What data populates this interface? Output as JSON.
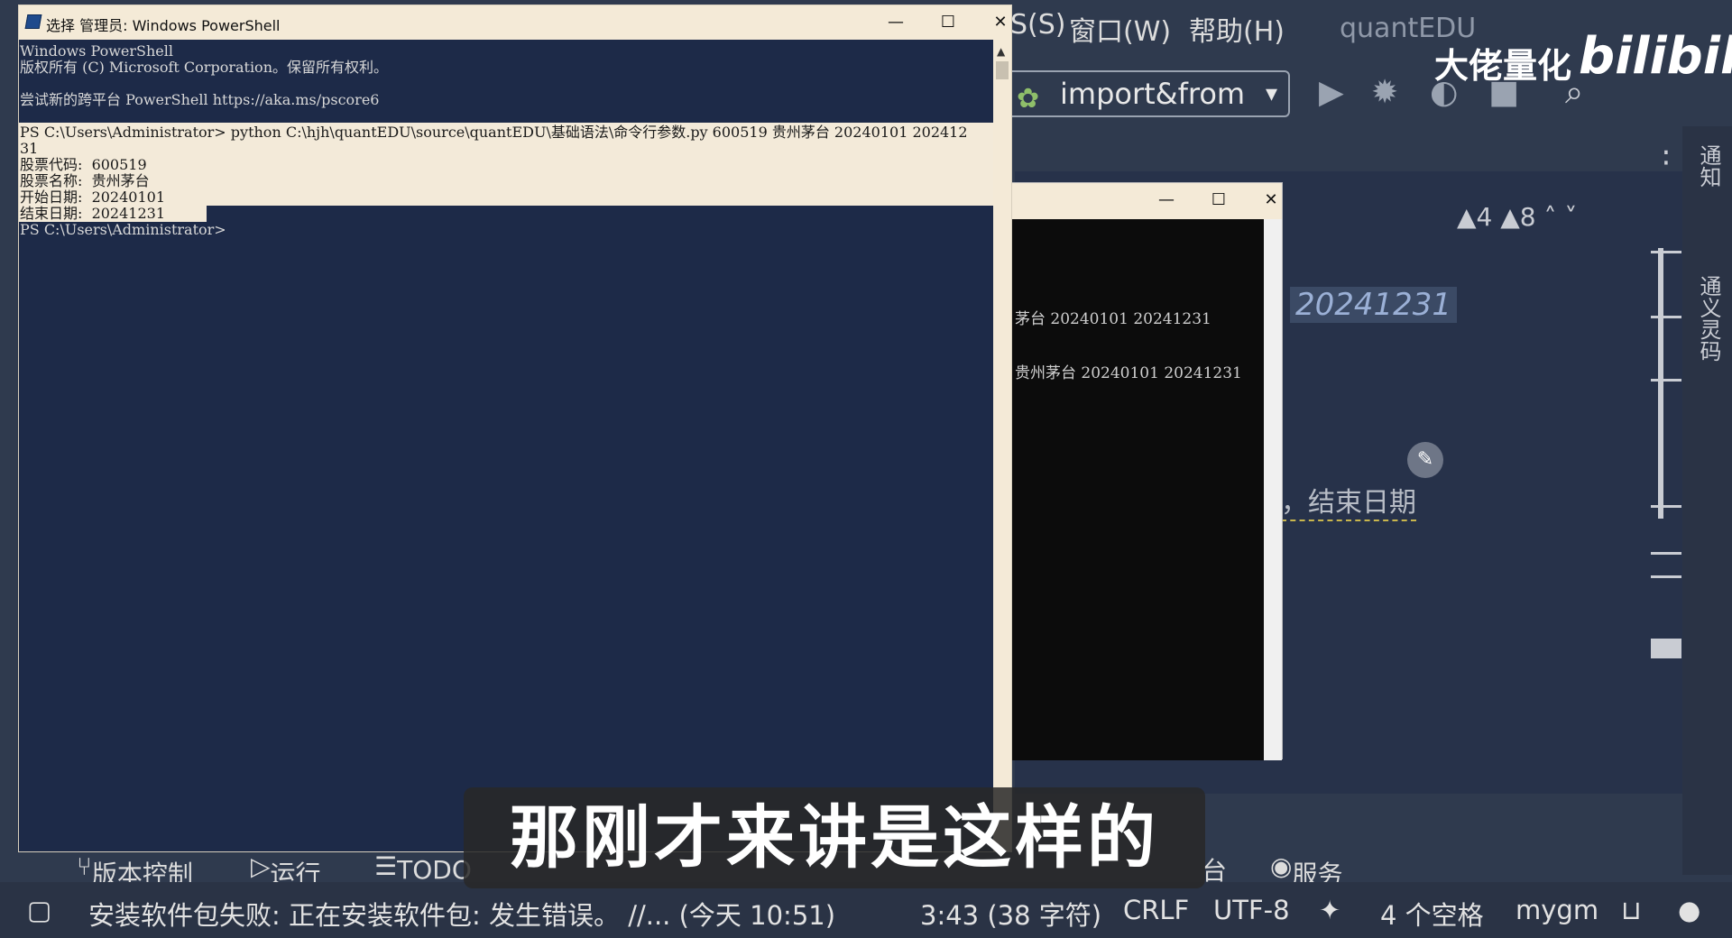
{
  "ide": {
    "menu": [
      "S(S)",
      "窗口(W)",
      "帮助(H)"
    ],
    "project": "quantEDU",
    "run_config": "import&from",
    "editor_line1": "20241231",
    "editor_line2": "，结束日期",
    "warnings": "▲4  ▲8  ˄  ˅",
    "right_notifications": "通知",
    "right_ai": "通义灵码",
    "toolwin": {
      "vcs": "版本控制",
      "run": "运行",
      "todo": "TODO",
      "services": "服务",
      "partial": "台"
    },
    "status": {
      "message": "安装软件包失败: 正在安装软件包: 发生错误。 //... (今天 10:51)",
      "position": "3:43 (38 字符)",
      "line_sep": "CRLF",
      "encoding": "UTF-8",
      "indent": "4 个空格",
      "interpreter": "mygm"
    }
  },
  "powershell": {
    "title": "选择 管理员: Windows PowerShell",
    "lines": [
      "Windows PowerShell",
      "版权所有 (C) Microsoft Corporation。保留所有权利。",
      "",
      "尝试新的跨平台 PowerShell https://aka.ms/pscore6",
      "",
      "PS C:\\Users\\Administrator> python C:\\hjh\\quantEDU\\source\\quantEDU\\基础语法\\命令行参数.py 600519 贵州茅台 20240101 202412",
      "31",
      "股票代码:  600519",
      "股票名称:  贵州茅台",
      "开始日期:  20240101",
      "结束日期:  20241231",
      "PS C:\\Users\\Administrator>"
    ]
  },
  "console": {
    "line1": "茅台 20240101 20241231",
    "line2": "贵州茅台 20240101 20241231"
  },
  "subtitle": "那刚才来讲是这样的",
  "watermark": {
    "text": "大佬量化",
    "logo": "bilibili"
  }
}
